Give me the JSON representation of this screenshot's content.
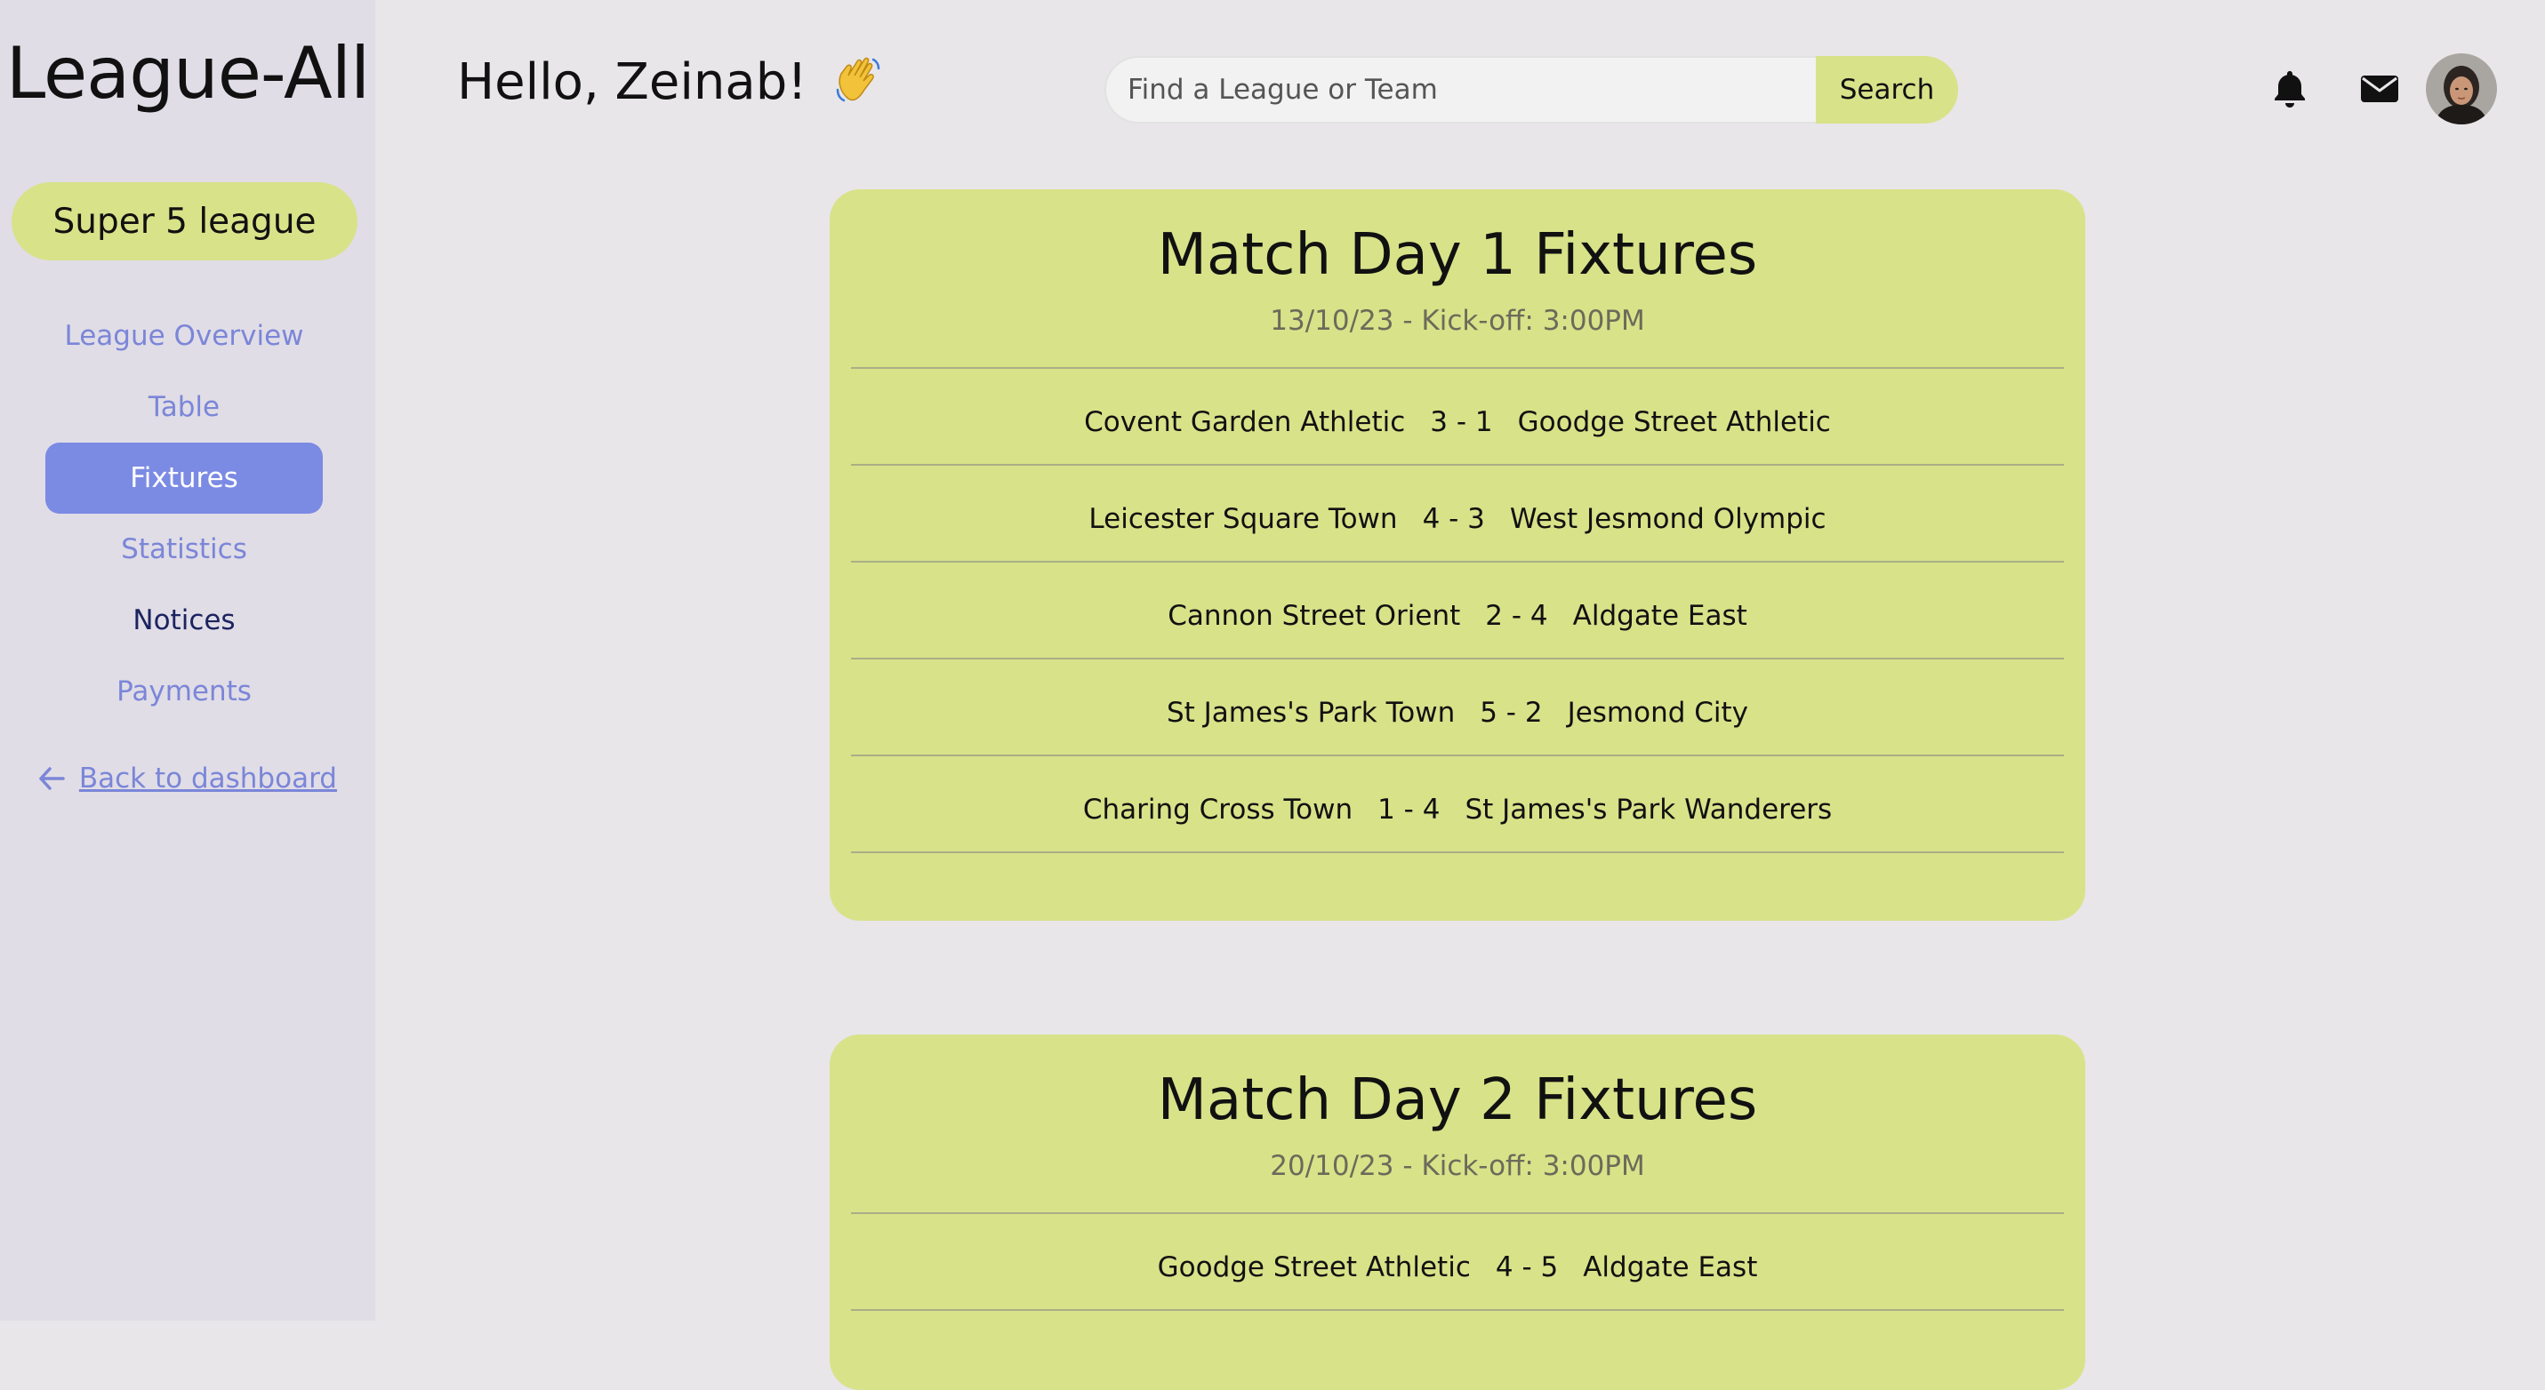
{
  "app": {
    "logo": "League-All"
  },
  "sidebar": {
    "league_name": "Super 5 league",
    "items": [
      {
        "label": "League Overview"
      },
      {
        "label": "Table"
      },
      {
        "label": "Fixtures",
        "active": true
      },
      {
        "label": "Statistics"
      },
      {
        "label": "Notices"
      },
      {
        "label": "Payments"
      }
    ],
    "back_label": "Back to dashboard"
  },
  "header": {
    "greeting": "Hello, Zeinab!",
    "search_placeholder": "Find a League or Team",
    "search_button": "Search",
    "icons": [
      "bell-icon",
      "envelope-icon",
      "avatar"
    ]
  },
  "colors": {
    "accent_lime": "#d8e289",
    "accent_blue": "#7b8ae3",
    "page_bg": "#e8e6e9",
    "sidebar_bg": "#e0dde6"
  },
  "matchdays": [
    {
      "title": "Match Day 1 Fixtures",
      "subtitle": "13/10/23 - Kick-off: 3:00PM",
      "fixtures": [
        {
          "home": "Covent Garden Athletic",
          "score": "3 - 1",
          "away": "Goodge Street Athletic"
        },
        {
          "home": "Leicester Square Town",
          "score": "4 - 3",
          "away": "West Jesmond Olympic"
        },
        {
          "home": "Cannon Street Orient",
          "score": "2 - 4",
          "away": "Aldgate East"
        },
        {
          "home": "St James's Park Town",
          "score": "5 - 2",
          "away": "Jesmond City"
        },
        {
          "home": "Charing Cross Town",
          "score": "1 - 4",
          "away": "St James's Park Wanderers"
        }
      ]
    },
    {
      "title": "Match Day 2 Fixtures",
      "subtitle": "20/10/23 - Kick-off: 3:00PM",
      "fixtures": [
        {
          "home": "Goodge Street Athletic",
          "score": "4 - 5",
          "away": "Aldgate East"
        }
      ]
    }
  ]
}
